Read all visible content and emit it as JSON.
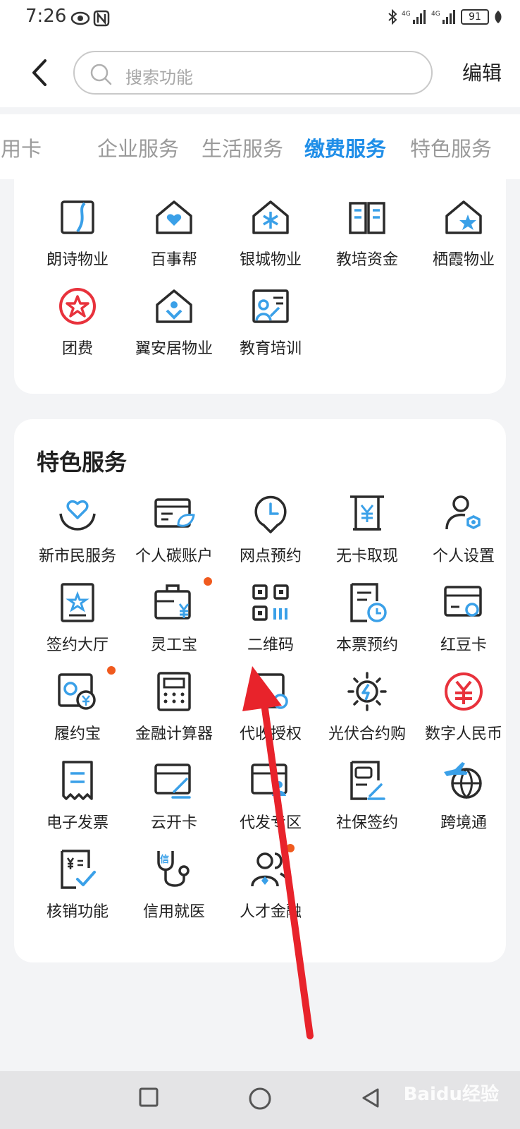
{
  "status": {
    "time": "7:26",
    "battery": "91",
    "signal_label_1": "4G",
    "signal_label_2": "4G"
  },
  "header": {
    "search_placeholder": "搜索功能",
    "edit_label": "编辑"
  },
  "tabs": [
    {
      "label": "信用卡",
      "active": false
    },
    {
      "label": "企业服务",
      "active": false
    },
    {
      "label": "生活服务",
      "active": false
    },
    {
      "label": "缴费服务",
      "active": true
    },
    {
      "label": "特色服务",
      "active": false
    }
  ],
  "payment_items": [
    {
      "label": "朗诗物业",
      "icon": "property-icon"
    },
    {
      "label": "百事帮",
      "icon": "heart-house-icon"
    },
    {
      "label": "银城物业",
      "icon": "snowflake-house-icon"
    },
    {
      "label": "教培资金",
      "icon": "book-icon"
    },
    {
      "label": "栖霞物业",
      "icon": "star-house-icon"
    },
    {
      "label": "团费",
      "icon": "star-badge-icon"
    },
    {
      "label": "翼安居物业",
      "icon": "person-house-icon"
    },
    {
      "label": "教育培训",
      "icon": "teacher-board-icon"
    }
  ],
  "special": {
    "title": "特色服务",
    "items": [
      {
        "label": "新市民服务",
        "icon": "heart-hands-icon"
      },
      {
        "label": "个人碳账户",
        "icon": "leaf-card-icon"
      },
      {
        "label": "网点预约",
        "icon": "clock-pin-icon"
      },
      {
        "label": "无卡取现",
        "icon": "atm-icon"
      },
      {
        "label": "个人设置",
        "icon": "user-gear-icon"
      },
      {
        "label": "签约大厅",
        "icon": "contract-star-icon"
      },
      {
        "label": "灵工宝",
        "icon": "briefcase-yen-icon"
      },
      {
        "label": "二维码",
        "icon": "qr-code-icon"
      },
      {
        "label": "本票预约",
        "icon": "document-clock-icon"
      },
      {
        "label": "红豆卡",
        "icon": "card-icon"
      },
      {
        "label": "履约宝",
        "icon": "safe-yen-icon"
      },
      {
        "label": "金融计算器",
        "icon": "calculator-icon"
      },
      {
        "label": "代收授权",
        "icon": "auth-card-icon"
      },
      {
        "label": "光伏合约购",
        "icon": "sun-bolt-icon"
      },
      {
        "label": "数字人民币",
        "icon": "digital-rmb-icon"
      },
      {
        "label": "电子发票",
        "icon": "receipt-icon"
      },
      {
        "label": "云开卡",
        "icon": "card-pen-icon"
      },
      {
        "label": "代发专区",
        "icon": "card-user-icon"
      },
      {
        "label": "社保签约",
        "icon": "social-security-icon"
      },
      {
        "label": "跨境通",
        "icon": "plane-globe-icon"
      },
      {
        "label": "核销功能",
        "icon": "check-document-icon"
      },
      {
        "label": "信用就医",
        "icon": "stethoscope-icon"
      },
      {
        "label": "人才金融",
        "icon": "people-icon"
      }
    ]
  },
  "watermark": "Baidu经验",
  "colors": {
    "accent": "#1f8ee8",
    "icon_dark": "#2b2b2b",
    "icon_blue": "#3aa0e8",
    "badge": "#f05a1e",
    "red": "#e8323c"
  }
}
